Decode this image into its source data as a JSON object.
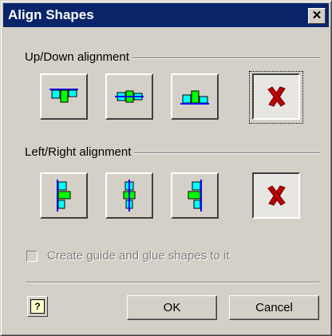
{
  "window": {
    "title": "Align Shapes",
    "close_glyph": "✕"
  },
  "updown": {
    "label": "Up/Down alignment",
    "buttons": [
      {
        "name": "align-top",
        "icon": "align-top-icon"
      },
      {
        "name": "align-middle",
        "icon": "align-middle-icon"
      },
      {
        "name": "align-bottom",
        "icon": "align-bottom-icon"
      },
      {
        "name": "no-align",
        "icon": "red-x-icon",
        "pressed": true
      }
    ]
  },
  "leftright": {
    "label": "Left/Right alignment",
    "buttons": [
      {
        "name": "align-left",
        "icon": "align-left-icon"
      },
      {
        "name": "align-center",
        "icon": "align-center-icon"
      },
      {
        "name": "align-right",
        "icon": "align-right-icon"
      },
      {
        "name": "no-align",
        "icon": "red-x-icon",
        "pressed": true
      }
    ]
  },
  "options": {
    "guide_label": "Create guide and glue shapes to it",
    "guide_checked": false,
    "guide_enabled": false
  },
  "footer": {
    "help_glyph": "?",
    "ok_label": "OK",
    "cancel_label": "Cancel"
  },
  "colors": {
    "shape_fill": "#00ff00",
    "guide_line": "#0000ff",
    "shape_accent": "#00ffff",
    "x_red": "#c00000"
  }
}
